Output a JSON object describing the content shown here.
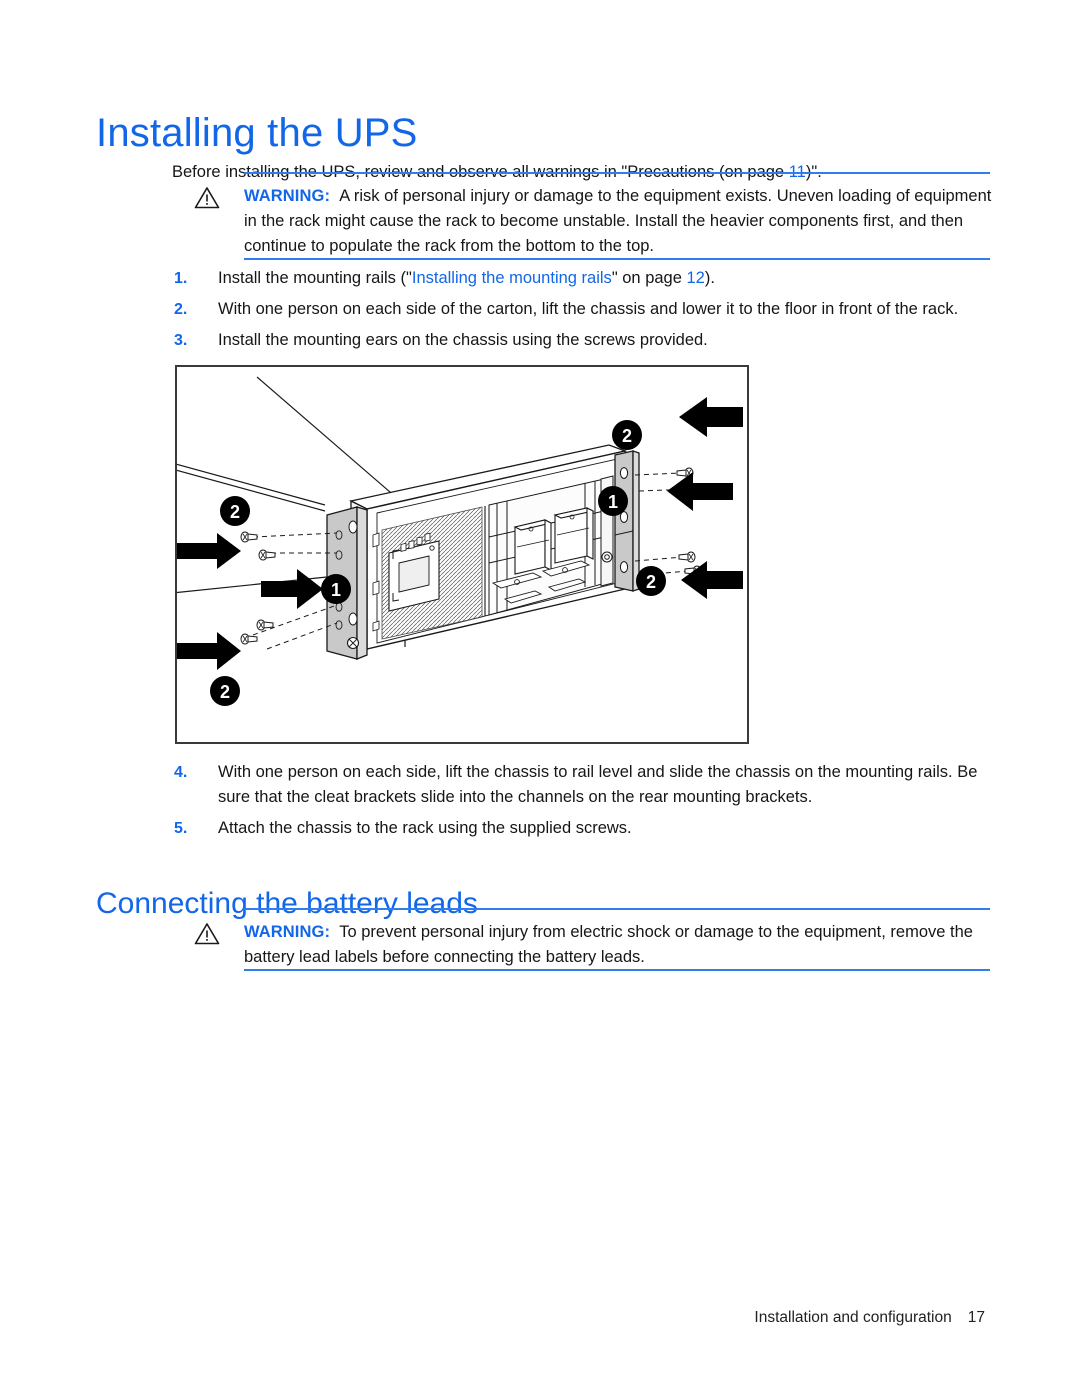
{
  "document": {
    "heading": "Installing the UPS",
    "intro_prefix": "Before installing the UPS, review and observe all warnings in \"Precautions (on page ",
    "intro_xref": "11",
    "intro_suffix": ")\"."
  },
  "warning_1": {
    "icon": "warning-triangle-icon",
    "label": "WARNING:",
    "text": "A risk of personal injury or damage to the equipment exists. Uneven loading of equipment in the rack might cause the rack to become unstable. Install the heavier components first, and then continue to populate the rack from the bottom to the top."
  },
  "steps_a": [
    {
      "num": "1.",
      "prefix": "Install the mounting rails (\"",
      "xref": "Installing the mounting rails",
      "middle": "\" on page ",
      "page_xref": "12",
      "suffix": ")."
    },
    {
      "num": "2.",
      "prefix": "With one person on each side of the carton, lift the chassis and lower it to the floor in front of the rack.",
      "xref": "",
      "middle": "",
      "page_xref": "",
      "suffix": ""
    },
    {
      "num": "3.",
      "prefix": "Install the mounting ears on the chassis using the screws provided.",
      "xref": "",
      "middle": "",
      "page_xref": "",
      "suffix": ""
    }
  ],
  "figure": {
    "caption": "",
    "alt": "UPS chassis with mounting ears installed using screws; callouts 1 and 2 with arrows",
    "callouts": [
      {
        "id": "left-top",
        "label": "2"
      },
      {
        "id": "left-middle",
        "label": "1"
      },
      {
        "id": "left-bottom",
        "label": "2"
      },
      {
        "id": "right-top",
        "label": "2"
      },
      {
        "id": "right-middle",
        "label": "1"
      },
      {
        "id": "right-bottom",
        "label": "2"
      }
    ]
  },
  "steps_b": [
    {
      "num": "4.",
      "text": "With one person on each side, lift the chassis to rail level and slide the chassis on the mounting rails. Be sure that the cleat brackets slide into the channels on the rear mounting brackets."
    },
    {
      "num": "5.",
      "text": "Attach the chassis to the rack using the supplied screws."
    }
  ],
  "section_2": {
    "heading": "Connecting the battery leads"
  },
  "warning_2": {
    "icon": "warning-triangle-icon",
    "label": "WARNING:",
    "text": "To prevent personal injury from electric shock or damage to the equipment, remove the battery lead labels before connecting the battery leads."
  },
  "footer": {
    "section": "Installation and configuration",
    "page_number": "17"
  },
  "colors": {
    "accent_blue": "#1266e8",
    "rule_blue": "#2f7ef0",
    "body_text": "#161616",
    "figure_border": "#3a3a3a",
    "panel_gray": "#c9c9c9"
  }
}
